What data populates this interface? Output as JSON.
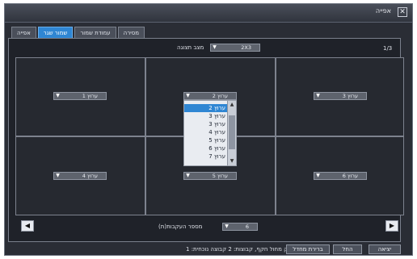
{
  "window": {
    "title": "אפייה",
    "close_glyph": "✕"
  },
  "tabs": [
    {
      "label": "אפייה",
      "active": false
    },
    {
      "label": "שמור שגר",
      "active": true
    },
    {
      "label": "עמודת שמור",
      "active": false
    },
    {
      "label": "מסירה",
      "active": false
    }
  ],
  "top": {
    "page": "1/3",
    "layout_label": "מצב תצוגה",
    "layout_value": "2X3"
  },
  "channels": {
    "c1": "ערוץ 1",
    "c2": "ערוץ 2",
    "c3": "ערוץ 3",
    "c4": "ערוץ 4",
    "c5": "ערוץ 5",
    "c6": "ערוץ 6"
  },
  "dropdown": {
    "options": [
      "ערוץ 2",
      "ערוץ 3",
      "ערוץ 3",
      "ערוץ 4",
      "ערוץ 5",
      "ערוץ 6",
      "ערוץ 7"
    ],
    "selected_index": 0
  },
  "bottom": {
    "label": "מספר העקבות(ת)",
    "value": "6",
    "prev_glyph": "◀",
    "next_glyph": "▶"
  },
  "status": "בדיק מחול חקף, קבוצות: 2 קבוצה נוכחית: 1",
  "buttons": {
    "b1": "יציאה",
    "b2": "החל",
    "b3": "ברירת מחדל"
  },
  "colors": {
    "accent": "#2f86d3",
    "window_bg": "#2a2d35"
  }
}
